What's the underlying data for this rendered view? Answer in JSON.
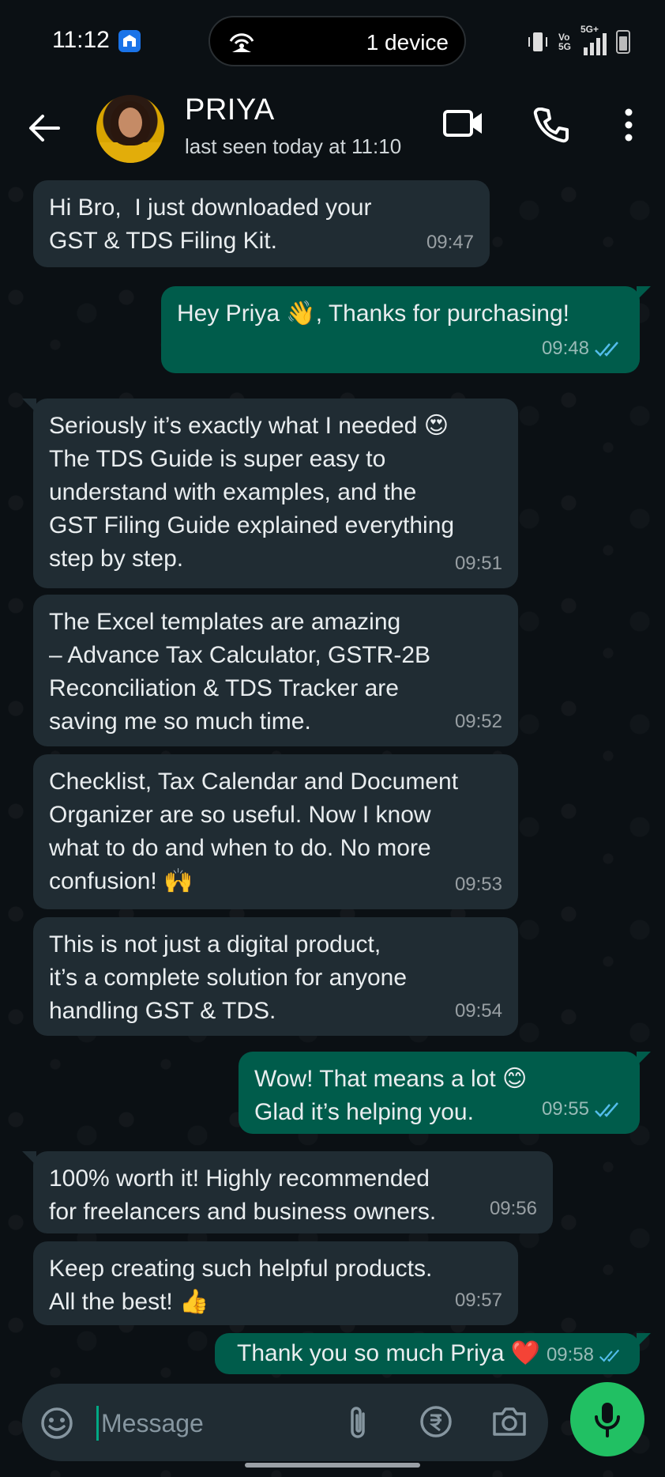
{
  "status_bar": {
    "time": "11:12",
    "hotspot_label": "1 device",
    "network": "Vo 5G",
    "network_type": "5G+"
  },
  "header": {
    "contact_name": "PRIYA",
    "last_seen": "last seen today at 11:10"
  },
  "messages": [
    {
      "dir": "in",
      "text": "Hi Bro,  I just downloaded your\nGST & TDS Filing Kit.",
      "time": "09:47"
    },
    {
      "dir": "out",
      "text": "Hey Priya 👋, Thanks for purchasing!",
      "time": "09:48"
    },
    {
      "dir": "in",
      "text": "Seriously it’s exactly what I needed 😍\nThe TDS Guide is super easy to\nunderstand with examples, and the\nGST Filing Guide explained everything\nstep by step.",
      "time": "09:51"
    },
    {
      "dir": "in",
      "text": "The Excel templates are amazing\n– Advance Tax Calculator, GSTR-2B\nReconciliation & TDS Tracker are\nsaving me so much time.",
      "time": "09:52"
    },
    {
      "dir": "in",
      "text": "Checklist, Tax Calendar and Document\nOrganizer are so useful. Now I know\nwhat to do and when to do. No more\nconfusion! 🙌",
      "time": "09:53"
    },
    {
      "dir": "in",
      "text": "This is not just a digital product,\nit’s a complete solution for anyone\nhandling GST & TDS.",
      "time": "09:54"
    },
    {
      "dir": "out",
      "text": "Wow! That means a lot 😊\nGlad it’s helping you.",
      "time": "09:55"
    },
    {
      "dir": "in",
      "text": "100% worth it! Highly recommended\nfor freelancers and business owners.",
      "time": "09:56"
    },
    {
      "dir": "in",
      "text": "Keep creating such helpful products.\nAll the best! 👍",
      "time": "09:57"
    },
    {
      "dir": "out",
      "text": "Thank you so much Priya ❤️",
      "time": "09:58"
    }
  ],
  "composer": {
    "placeholder": "Message"
  },
  "icons": {
    "back": "arrow-left-icon",
    "video": "video-call-icon",
    "call": "phone-icon",
    "menu": "more-vert-icon",
    "emoji": "emoji-icon",
    "attach": "attach-icon",
    "payment": "rupee-icon",
    "camera": "camera-icon",
    "mic": "mic-icon"
  },
  "colors": {
    "incoming_bubble": "#202c33",
    "outgoing_bubble": "#005c4b",
    "read_ticks": "#53bdeb",
    "accent": "#21c063"
  }
}
